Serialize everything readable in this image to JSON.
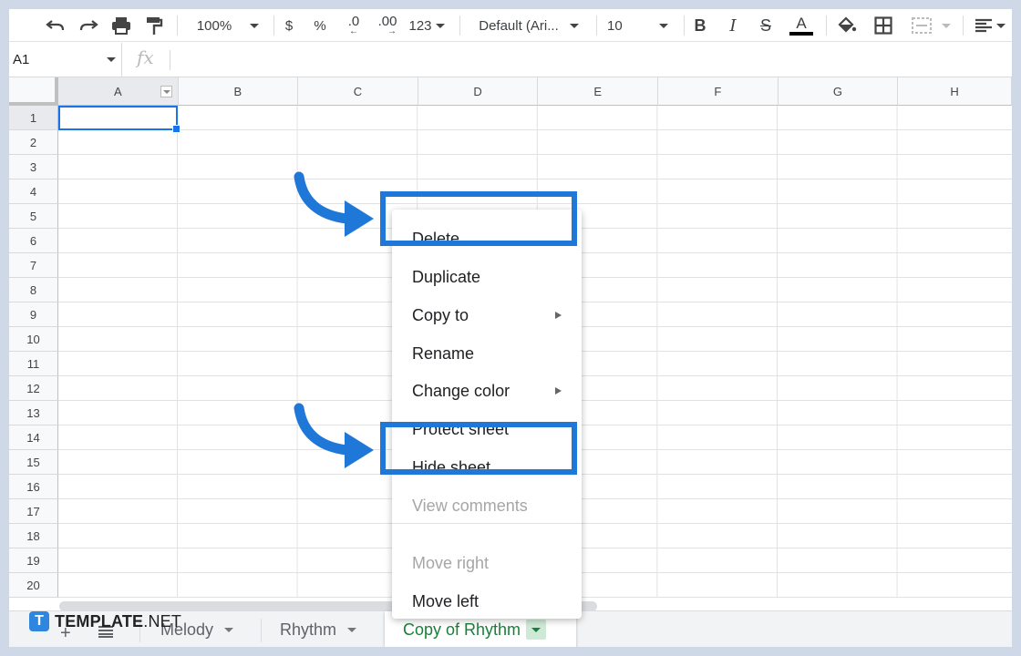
{
  "toolbar": {
    "zoom": "100%",
    "currency": "$",
    "percent": "%",
    "decrease_decimal": ".0",
    "increase_decimal": ".00",
    "number_format": "123",
    "font": "Default (Ari...",
    "font_size": "10",
    "bold": "B",
    "italic": "I",
    "strike": "S",
    "text_color": "A",
    "icons": [
      "undo-icon",
      "redo-icon",
      "print-icon",
      "paint-format-icon",
      "bold-icon",
      "italic-icon",
      "strikethrough-icon",
      "text-color-icon",
      "fill-color-icon",
      "borders-icon",
      "merge-cells-icon",
      "align-icon"
    ]
  },
  "formula_bar": {
    "cell_ref": "A1",
    "fx_label": "fx"
  },
  "grid": {
    "columns": [
      "A",
      "B",
      "C",
      "D",
      "E",
      "F",
      "G",
      "H"
    ],
    "rows": [
      "1",
      "2",
      "3",
      "4",
      "5",
      "6",
      "7",
      "8",
      "9",
      "10",
      "11",
      "12",
      "13",
      "14",
      "15",
      "16",
      "17",
      "18",
      "19",
      "20"
    ],
    "active_cell": "A1"
  },
  "context_menu": {
    "items": [
      {
        "label": "Delete",
        "disabled": false,
        "submenu": false
      },
      {
        "label": "Duplicate",
        "disabled": false,
        "submenu": false
      },
      {
        "label": "Copy to",
        "disabled": false,
        "submenu": true
      },
      {
        "label": "Rename",
        "disabled": false,
        "submenu": false
      },
      {
        "label": "Change color",
        "disabled": false,
        "submenu": true
      },
      {
        "label": "Protect sheet",
        "disabled": false,
        "submenu": false
      },
      {
        "label": "Hide sheet",
        "disabled": false,
        "submenu": false
      },
      {
        "label": "View comments",
        "disabled": true,
        "submenu": false
      },
      {
        "label": "Move right",
        "disabled": true,
        "submenu": false
      },
      {
        "label": "Move left",
        "disabled": false,
        "submenu": false
      }
    ]
  },
  "sheet_tabs": {
    "tabs": [
      {
        "label": "Melody",
        "active": false
      },
      {
        "label": "Rhythm",
        "active": false
      },
      {
        "label": "Copy of Rhythm",
        "active": true
      }
    ]
  },
  "watermark": {
    "logo_letter": "T",
    "brand": "TEMPLATE",
    "suffix": ".NET"
  },
  "colors": {
    "highlight": "#1f78d7",
    "active_tab_text": "#188038",
    "selection": "#1a73e8"
  }
}
